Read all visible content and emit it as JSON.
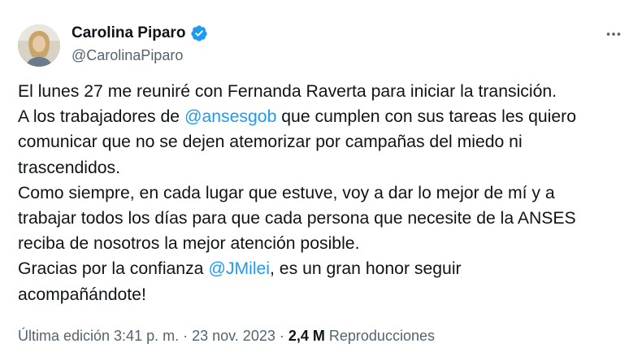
{
  "author": {
    "name": "Carolina Piparo",
    "handle": "@CarolinaPiparo",
    "verified_color": "#1d9bf0"
  },
  "more_icon": "more-horizontal-icon",
  "tweet": {
    "line1": "El lunes 27 me reuniré con Fernanda Raverta para iniciar la transición.",
    "line2_pre": "A los trabajadores de ",
    "line2_mention": "@ansesgob",
    "line2_post": " que cumplen con sus tareas les quiero",
    "line3": "comunicar que no se dejen atemorizar por campañas del miedo ni",
    "line4": "trascendidos.",
    "line5": "Como siempre, en cada lugar que estuve, voy a dar lo mejor de mí y a",
    "line6": "trabajar todos los días para que cada persona que necesite de la ANSES",
    "line7": "reciba de nosotros la mejor atención posible.",
    "line8_pre": "Gracias por la confianza ",
    "line8_mention": "@JMilei",
    "line8_post": ", es un gran honor seguir",
    "line9": "acompañándote!"
  },
  "meta": {
    "edited_label": "Última edición 3:41 p. m.",
    "separator1": " · ",
    "date": "23 nov. 2023",
    "separator2": " · ",
    "views_count": "2,4 M",
    "views_label": " Reproducciones"
  },
  "colors": {
    "link": "#1d9bf0",
    "text": "#0f1419",
    "secondary": "#536471"
  }
}
